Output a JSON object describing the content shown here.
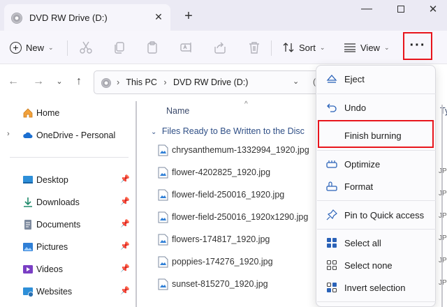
{
  "window": {
    "tab_title": "DVD RW Drive (D:)",
    "tab_close": "✕",
    "new_tab": "+",
    "minimize": "—",
    "close": "✕"
  },
  "toolbar": {
    "new_label": "New",
    "sort_label": "Sort",
    "view_label": "View",
    "more_label": "···",
    "chevron": "⌄",
    "icons": [
      "cut-icon",
      "copy-icon",
      "paste-icon",
      "rename-icon",
      "share-icon",
      "delete-icon"
    ],
    "highlight_color": "#e8151c"
  },
  "nav": {
    "back": "←",
    "forward": "→",
    "dropdown": "⌄",
    "up": "↑",
    "breadcrumb": [
      "This PC",
      "DVD RW Drive (D:)"
    ],
    "address_dropdown": "⌄",
    "cut_off_glyph": "("
  },
  "sidebar": {
    "items": [
      {
        "label": "Home",
        "icon": "home-icon",
        "expander": "",
        "pinned": false
      },
      {
        "label": "OneDrive - Personal",
        "icon": "cloud-icon",
        "expander": "›",
        "pinned": false
      },
      {
        "label": "Desktop",
        "icon": "desktop-icon",
        "expander": "",
        "pinned": true
      },
      {
        "label": "Downloads",
        "icon": "download-icon",
        "expander": "",
        "pinned": true
      },
      {
        "label": "Documents",
        "icon": "documents-icon",
        "expander": "",
        "pinned": true
      },
      {
        "label": "Pictures",
        "icon": "pictures-icon",
        "expander": "",
        "pinned": true
      },
      {
        "label": "Videos",
        "icon": "videos-icon",
        "expander": "",
        "pinned": true
      },
      {
        "label": "Websites",
        "icon": "websites-icon",
        "expander": "",
        "pinned": true
      }
    ],
    "pin_glyph": "📌"
  },
  "filelist": {
    "column_name": "Name",
    "column_type": "Ty",
    "sort_caret": "^",
    "group_chevron": "⌄",
    "group_header": "Files Ready to Be Written to the Disc",
    "type_value": "JP",
    "files": [
      "chrysanthemum-1332994_1920.jpg",
      "flower-4202825_1920.jpg",
      "flower-field-250016_1920.jpg",
      "flower-field-250016_1920x1290.jpg",
      "flowers-174817_1920.jpg",
      "poppies-174276_1920.jpg",
      "sunset-815270_1920.jpg"
    ]
  },
  "menu": {
    "items": [
      {
        "label": "Eject",
        "icon": "eject-icon"
      },
      {
        "label": "Undo",
        "icon": "undo-icon"
      },
      {
        "label": "Finish burning",
        "icon": "",
        "highlighted": true
      },
      {
        "label": "Optimize",
        "icon": "optimize-icon"
      },
      {
        "label": "Format",
        "icon": "format-icon"
      },
      {
        "label": "Pin to Quick access",
        "icon": "pin-icon"
      },
      {
        "label": "Select all",
        "icon": "select-all-icon"
      },
      {
        "label": "Select none",
        "icon": "select-none-icon"
      },
      {
        "label": "Invert selection",
        "icon": "invert-selection-icon"
      }
    ]
  }
}
